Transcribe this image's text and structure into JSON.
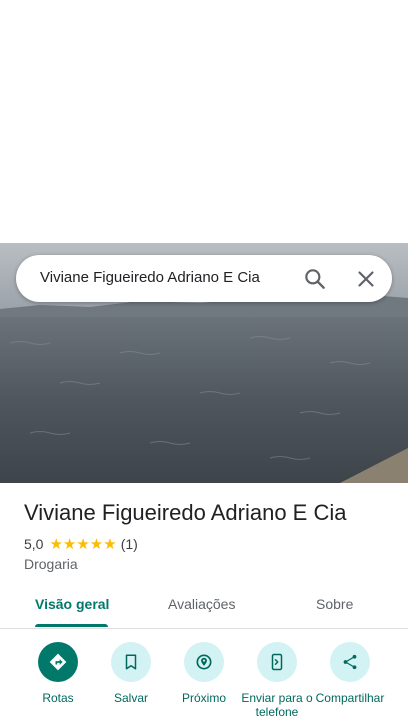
{
  "search": {
    "query": "Viviane Figueiredo Adriano E Cia"
  },
  "place": {
    "name": "Viviane Figueiredo Adriano E Cia",
    "rating": "5,0",
    "stars": "★★★★★",
    "rating_value": 5,
    "reviews_count": "(1)",
    "category": "Drogaria"
  },
  "tabs": [
    {
      "label": "Visão geral",
      "active": true
    },
    {
      "label": "Avaliações",
      "active": false
    },
    {
      "label": "Sobre",
      "active": false
    }
  ],
  "actions": [
    {
      "label": "Rotas",
      "icon": "directions-icon"
    },
    {
      "label": "Salvar",
      "icon": "bookmark-icon"
    },
    {
      "label": "Próximo",
      "icon": "nearby-icon"
    },
    {
      "label": "Enviar para o telefone",
      "icon": "send-to-phone-icon"
    },
    {
      "label": "Compartilhar",
      "icon": "share-icon"
    }
  ],
  "colors": {
    "accent": "#00796b",
    "action_bg": "#d2f2f3",
    "star": "#fbbc04"
  }
}
